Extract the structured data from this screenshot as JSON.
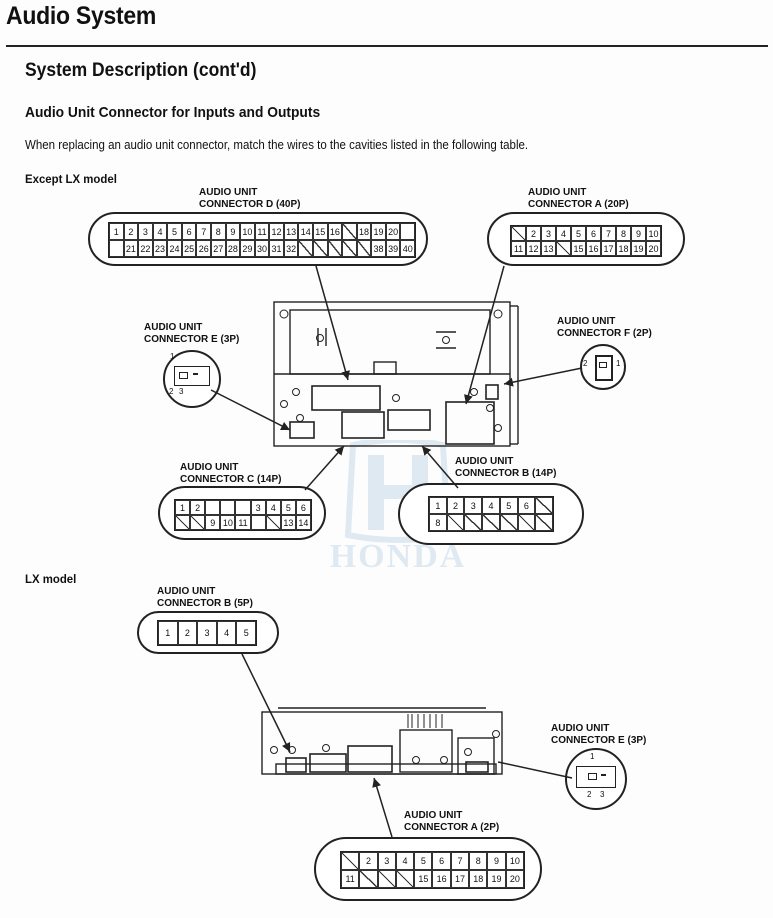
{
  "header": {
    "title": "Audio System",
    "section": "System Description (cont'd)",
    "subsection": "Audio Unit Connector for Inputs and Outputs",
    "intro": "When replacing an audio unit connector, match the wires to the cavities listed in the following table."
  },
  "watermark": "HONDA",
  "except_lx": {
    "heading": "Except LX model",
    "connector_d": {
      "label_line1": "AUDIO UNIT",
      "label_line2": "CONNECTOR D (40P)",
      "row1": [
        "1",
        "2",
        "3",
        "4",
        "5",
        "6",
        "7",
        "8",
        "9",
        "10",
        "11",
        "12",
        "13",
        "14",
        "15",
        "16",
        "/",
        "18",
        "19",
        "20",
        ""
      ],
      "row2": [
        "",
        "21",
        "22",
        "23",
        "24",
        "25",
        "26",
        "27",
        "28",
        "29",
        "30",
        "31",
        "32",
        "/",
        "/",
        "/",
        "/",
        "/",
        "38",
        "39",
        "40"
      ]
    },
    "connector_a": {
      "label_line1": "AUDIO UNIT",
      "label_line2": "CONNECTOR A (20P)",
      "row1": [
        "/",
        "2",
        "3",
        "4",
        "5",
        "6",
        "7",
        "8",
        "9",
        "10"
      ],
      "row2": [
        "11",
        "12",
        "13",
        "/",
        "15",
        "16",
        "17",
        "18",
        "19",
        "20"
      ]
    },
    "connector_e": {
      "label_line1": "AUDIO UNIT",
      "label_line2": "CONNECTOR E (3P)",
      "pins": [
        "1",
        "2",
        "3"
      ]
    },
    "connector_f": {
      "label_line1": "AUDIO UNIT",
      "label_line2": "CONNECTOR F (2P)",
      "pins": [
        "2",
        "1"
      ]
    },
    "connector_c": {
      "label_line1": "AUDIO UNIT",
      "label_line2": "CONNECTOR C (14P)",
      "row1": [
        "1",
        "2",
        "",
        "",
        "",
        "3",
        "4",
        "5",
        "6"
      ],
      "row2": [
        "/",
        "/",
        "9",
        "10",
        "11",
        "",
        "/",
        "13",
        "14"
      ]
    },
    "connector_b": {
      "label_line1": "AUDIO UNIT",
      "label_line2": "CONNECTOR B (14P)",
      "row1": [
        "1",
        "2",
        "3",
        "4",
        "5",
        "6",
        "/"
      ],
      "row2": [
        "8",
        "/",
        "/",
        "/",
        "/",
        "/",
        "/"
      ]
    }
  },
  "lx": {
    "heading": "LX model",
    "connector_b": {
      "label_line1": "AUDIO UNIT",
      "label_line2": "CONNECTOR B (5P)",
      "pins": [
        "1",
        "2",
        "3",
        "4",
        "5"
      ]
    },
    "connector_e": {
      "label_line1": "AUDIO UNIT",
      "label_line2": "CONNECTOR E (3P)",
      "pins": [
        "1",
        "2",
        "3"
      ]
    },
    "connector_a": {
      "label_line1": "AUDIO UNIT",
      "label_line2": "CONNECTOR A (2P)",
      "row1": [
        "/",
        "2",
        "3",
        "4",
        "5",
        "6",
        "7",
        "8",
        "9",
        "10"
      ],
      "row2": [
        "11",
        "/",
        "/",
        "/",
        "15",
        "16",
        "17",
        "18",
        "19",
        "20"
      ]
    }
  }
}
